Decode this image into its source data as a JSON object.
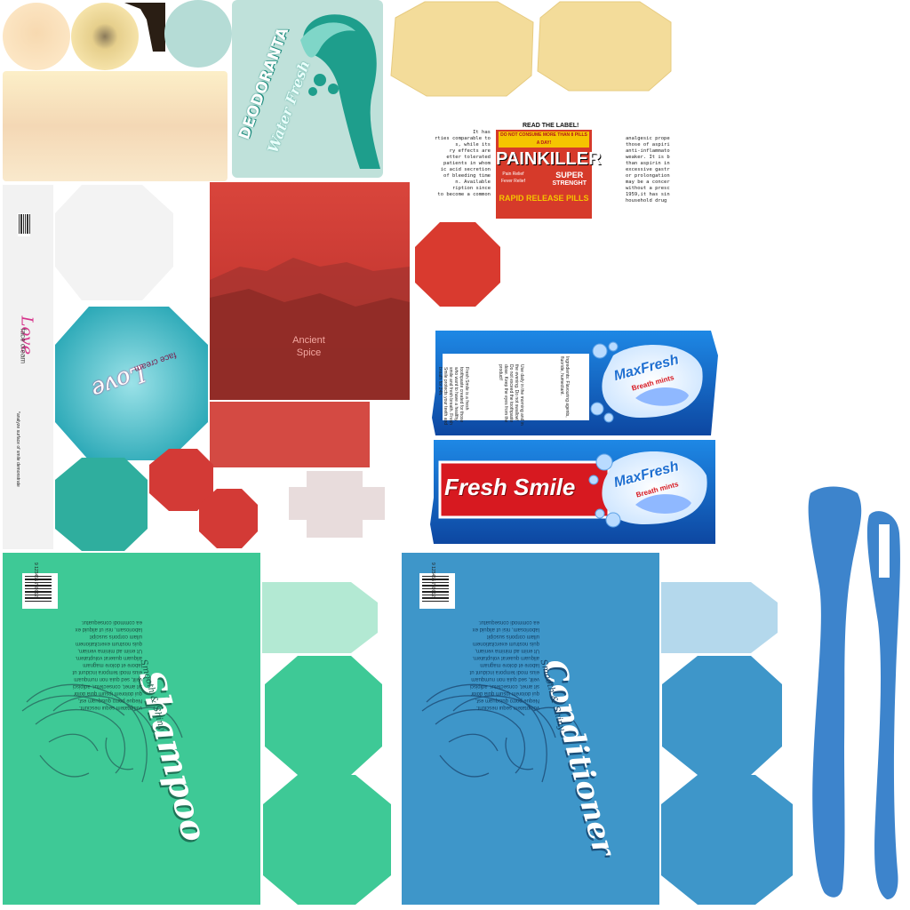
{
  "deodorant": {
    "brand": "DEODORANTA",
    "variant": "Water Fresh"
  },
  "painkiller": {
    "header": "READ THE LABEL!",
    "warning": "DO NOT CONSUME MORE THAN 8 PILLS A DAY!",
    "title": "PAINKILLER",
    "relief_1": "Pain Relief",
    "relief_2": "Fever Relief",
    "strength_1": "SUPER",
    "strength_2": "STRENGHT",
    "footer": "RAPID RELEASE PILLS",
    "left_text": "It has\nrties comparable to\ns, while its\nry effects are\netter tolerated\npatients in whom\nic acid secretion\nof bleeding time\nn. Available\nription since\nto become a common",
    "right_text": "analgesic prope\nthose of aspiri\nanti-inflammato\nweaker. It is b\nthan aspirin in\nexcessive gastr\nor prolongation\nmay be a concer\nwithout a presc\n1959,it has sin\nhousehold drug"
  },
  "face_cream": {
    "brand": "Love",
    "product": "face cream",
    "info": "*analyze surface of smile demonstrate"
  },
  "ancient_spice": {
    "line1": "Ancient",
    "line2": "Spice"
  },
  "toothpaste": {
    "brand": "MaxFresh",
    "product": "Breath mints",
    "banner": "Fresh Smile",
    "description": "Fresh Smile is a fresh toothpaste created for those who want to have a healthy smile and fresh breath. Fresh Smile protects your teeth and breath for 24h.",
    "usage": "Use daily in the morning and in the evening. Do not swallow! Do not exceed the toothpaste dose. Keep the eyes from the product!",
    "ingredients": "Ingredients: Flavouring agents, fluoride, humectant."
  },
  "shampoo": {
    "title": "Shampoo",
    "subtitle": "Smooth & Shiny",
    "barcode": "9 123456 789012",
    "lorem": "voluptatem sequi nesciunt. Neque porro quisquam est, qui dolorem ipsum quia dolor sit amet, consectetur, adipisci velit, sed quia non numquam eius modi tempora incidunt ut labore et dolore magnam aliquam quaerat voluptatem. Ut enim ad minima veniam, quis nostrum exercitationem ullam corporis suscipit laboriosam, nisi ut aliquid ex ea commodi consequatur."
  },
  "conditioner": {
    "title": "Conditioner",
    "subtitle": "Smooth & Shiny",
    "barcode": "9 123456 789012",
    "lorem": "voluptatem sequi nesciunt. Neque porro quisquam est, qui dolorem ipsum quia dolor sit amet, consectetur, adipisci velit, sed quia non numquam eius modi tempora incidunt ut labore et dolore magnam aliquam quaerat voluptatem. Ut enim ad minima veniam, quis nostrum exercitationem ullam corporis suscipit laboriosam, nisi ut aliquid ex ea commodi consequatur."
  },
  "colors": {
    "shampoo_green": "#3ec996",
    "conditioner_blue": "#3e96c9",
    "toothbrush_blue": "#3d84cc",
    "painkiller_red": "#d63a2a",
    "spice_red": "#d9463f",
    "teal": "#3bb3a8",
    "toothpaste_blue": "#1565c0"
  }
}
